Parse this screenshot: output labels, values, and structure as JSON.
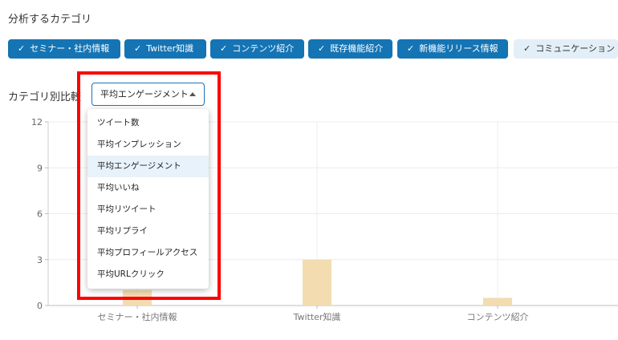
{
  "categories_section": {
    "title": "分析するカテゴリ",
    "chips": [
      {
        "label": "セミナー・社内情報",
        "selected": true
      },
      {
        "label": "Twitter知識",
        "selected": true
      },
      {
        "label": "コンテンツ紹介",
        "selected": true
      },
      {
        "label": "既存機能紹介",
        "selected": true
      },
      {
        "label": "新機能リリース情報",
        "selected": true
      },
      {
        "label": "コミュニケーション",
        "selected": false
      }
    ],
    "check_glyph": "✓"
  },
  "compare": {
    "label": "カテゴリ別比較",
    "selected_metric": "平均エンゲージメント",
    "options": [
      "ツイート数",
      "平均インプレッション",
      "平均エンゲージメント",
      "平均いいね",
      "平均リツイート",
      "平均リプライ",
      "平均プロフィールアクセス",
      "平均URLクリック"
    ],
    "selected_index": 2
  },
  "colors": {
    "chip_selected": "#1474b4",
    "chip_unselected": "#e3eff8",
    "bar": "#f2dcb0",
    "highlight": "#ff0000",
    "accent_border": "#1a73b8"
  },
  "chart_data": {
    "type": "bar",
    "categories": [
      "セミナー・社内情報",
      "Twitter知識",
      "コンテンツ紹介"
    ],
    "values": [
      1,
      3,
      0.5
    ],
    "yticks": [
      "12",
      "9",
      "6",
      "3",
      "0"
    ],
    "ylim": [
      0,
      12
    ],
    "grid": true
  }
}
